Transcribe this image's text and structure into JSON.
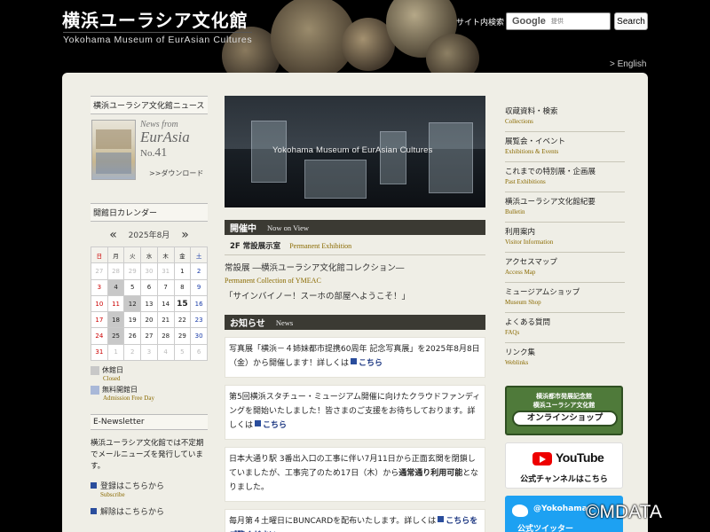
{
  "header": {
    "site_title": "横浜ユーラシア文化館",
    "site_subtitle": "Yokohama Museum of EurAsian Cultures",
    "search_label": "サイト内検索",
    "search_brand": "Google",
    "search_placeholder": "提供",
    "search_button": "Search",
    "english_link": "> English"
  },
  "left": {
    "news_heading": "横浜ユーラシア文化館ニュース",
    "news_from": "News from",
    "news_name": "EurAsia",
    "news_no_prefix": "No.",
    "news_no": "41",
    "news_download": ">>ダウンロード",
    "calendar_heading": "開館日カレンダー",
    "calendar_prev": "«",
    "calendar_month": "2025年8月",
    "calendar_next": "»",
    "weekdays": [
      "日",
      "月",
      "火",
      "水",
      "木",
      "金",
      "土"
    ],
    "weeks": [
      [
        "27",
        "28",
        "29",
        "30",
        "31",
        "1",
        "2"
      ],
      [
        "3",
        "4",
        "5",
        "6",
        "7",
        "8",
        "9"
      ],
      [
        "10",
        "11",
        "12",
        "13",
        "14",
        "15",
        "16"
      ],
      [
        "17",
        "18",
        "19",
        "20",
        "21",
        "22",
        "23"
      ],
      [
        "24",
        "25",
        "26",
        "27",
        "28",
        "29",
        "30"
      ],
      [
        "31",
        "1",
        "2",
        "3",
        "4",
        "5",
        "6"
      ]
    ],
    "legend_closed_jp": "休館日",
    "legend_closed_en": "Closed",
    "legend_free_jp": "無料開館日",
    "legend_free_en": "Admission Free Day",
    "enews_heading": "E-Newsletter",
    "enews_text": "横浜ユーラシア文化館では不定期でメールニューズを発行しています。",
    "subscribe_jp": "登録はこちらから",
    "subscribe_en": "Subscribe",
    "unsubscribe_jp": "解除はこちらから",
    "colors": {
      "closed": "#c8c8c8",
      "free": "#a9b8d8"
    }
  },
  "center": {
    "hero_caption": "Yokohama Museum of EurAsian Cultures",
    "now_jp": "開催中",
    "now_en": "Now on View",
    "exhibit_floor_jp": "2F 常設展示室",
    "exhibit_floor_en": "Permanent Exhibition",
    "exhibit_title": "常設展 ―横浜ユーラシア文化館コレクション―",
    "exhibit_en": "Permanent Collection of YMEAC",
    "exhibit_welcome": "「サインバイノー！スーホの部屋へようこそ！」",
    "news_jp": "お知らせ",
    "news_en": "News",
    "news_items": [
      {
        "text": "写真展「横浜－４姉妹都市提携60周年 記念写真展」を2025年8月8日（金）から開催します！詳しくは",
        "link": "こちら"
      },
      {
        "text": "第5回横浜スタチュー・ミュージアム開催に向けたクラウドファンディングを開始いたしました！皆さまのご支援をお待ちしております。詳しくは",
        "link": "こちら"
      },
      {
        "text_a": "日本大通り駅 3番出入口の工事に伴い7月11日から正面玄関を閉鎖していましたが、工事完了のため17日（木）から",
        "bold": "通常通り利用可能",
        "text_b": "となりました。"
      },
      {
        "text": "毎月第４土曜日にBUNCARDを配布いたします。詳しくは",
        "link": "こちらをご覧ください。"
      }
    ]
  },
  "right": {
    "nav": [
      {
        "jp": "収蔵資料・検索",
        "en": "Collections"
      },
      {
        "jp": "展覧会・イベント",
        "en": "Exhibitions & Events"
      },
      {
        "jp": "これまでの特別展・企画展",
        "en": "Past Exhibitions"
      },
      {
        "jp": "横浜ユーラシア文化館紀要",
        "en": "Bulletin"
      },
      {
        "jp": "利用案内",
        "en": "Visitor Information"
      },
      {
        "jp": "アクセスマップ",
        "en": "Access Map"
      },
      {
        "jp": "ミュージアムショップ",
        "en": "Museum Shop"
      },
      {
        "jp": "よくある質問",
        "en": "FAQs"
      },
      {
        "jp": "リンク集",
        "en": "Weblinks"
      }
    ],
    "shop_line1": "横浜都市発展記念館",
    "shop_line2": "横浜ユーラシア文化館",
    "shop_pill": "オンラインショップ",
    "yt_text": "YouTube",
    "yt_channel": "公式チャンネルはこちら",
    "tw_handle": "@Yokohama",
    "tw_sub": "公式ツイッター"
  },
  "watermark": "©MDATA"
}
